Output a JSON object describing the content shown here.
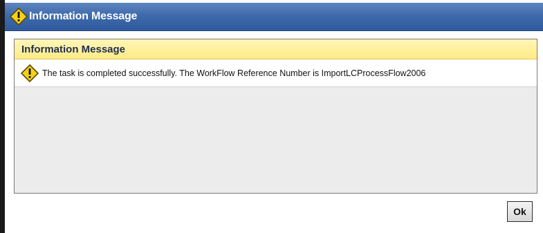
{
  "window": {
    "title": "Information Message",
    "title_icon": "warning-icon"
  },
  "panel": {
    "header": "Information Message",
    "message_icon": "warning-icon",
    "message": "The task is completed successfully. The WorkFlow Reference Number is ImportLCProcessFlow2006"
  },
  "buttons": {
    "ok_label": "Ok"
  },
  "colors": {
    "titlebar": "#3f6aab",
    "panel_header": "#ffeb86",
    "warning_fill": "#f7d117"
  }
}
